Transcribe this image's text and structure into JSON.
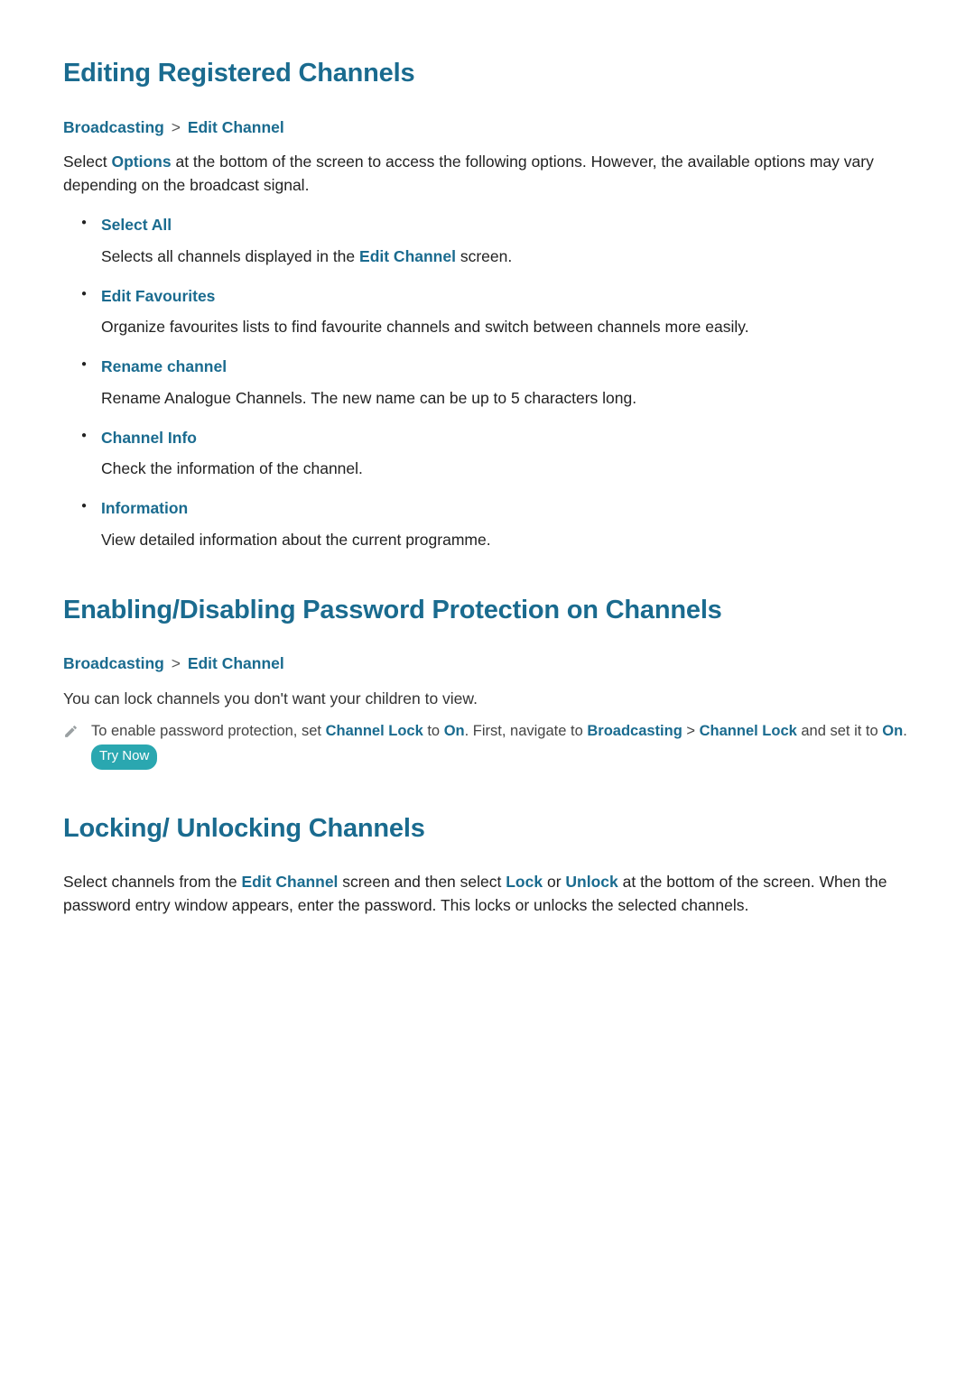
{
  "sections": {
    "edit": {
      "heading": "Editing Registered Channels",
      "bc1": "Broadcasting",
      "bc2": "Edit Channel",
      "intro_a": "Select ",
      "intro_options": "Options",
      "intro_b": " at the bottom of the screen to access the following options. However, the available options may vary depending on the broadcast signal.",
      "items": [
        {
          "title": "Select All",
          "desc_a": "Selects all channels displayed in the ",
          "desc_em": "Edit Channel",
          "desc_b": " screen."
        },
        {
          "title": "Edit Favourites",
          "desc_a": "Organize favourites lists to find favourite channels and switch between channels more easily.",
          "desc_em": "",
          "desc_b": ""
        },
        {
          "title": "Rename channel",
          "desc_a": "Rename Analogue Channels. The new name can be up to 5 characters long.",
          "desc_em": "",
          "desc_b": ""
        },
        {
          "title": "Channel Info",
          "desc_a": "Check the information of the channel.",
          "desc_em": "",
          "desc_b": ""
        },
        {
          "title": "Information",
          "desc_a": "View detailed information about the current programme.",
          "desc_em": "",
          "desc_b": ""
        }
      ]
    },
    "pwd": {
      "heading": "Enabling/Disabling Password Protection on Channels",
      "bc1": "Broadcasting",
      "bc2": "Edit Channel",
      "line1": "You can lock channels you don't want your children to view.",
      "note_a": "To enable password protection, set ",
      "note_c1": "Channel Lock",
      "note_b": " to ",
      "note_on1": "On",
      "note_c": ". First, navigate to ",
      "note_c2": "Broadcasting",
      "sep": " > ",
      "note_c3": "Channel Lock",
      "note_d": " and set it to ",
      "note_on2": "On",
      "note_e": ". ",
      "try_now": "Try Now"
    },
    "lock": {
      "heading": "Locking/ Unlocking Channels",
      "body_a": "Select channels from the ",
      "body_em1": "Edit Channel",
      "body_b": " screen and then select ",
      "body_em2": "Lock",
      "body_c": " or ",
      "body_em3": "Unlock",
      "body_d": " at the bottom of the screen. When the password entry window appears, enter the password. This locks or unlocks the selected channels."
    }
  }
}
